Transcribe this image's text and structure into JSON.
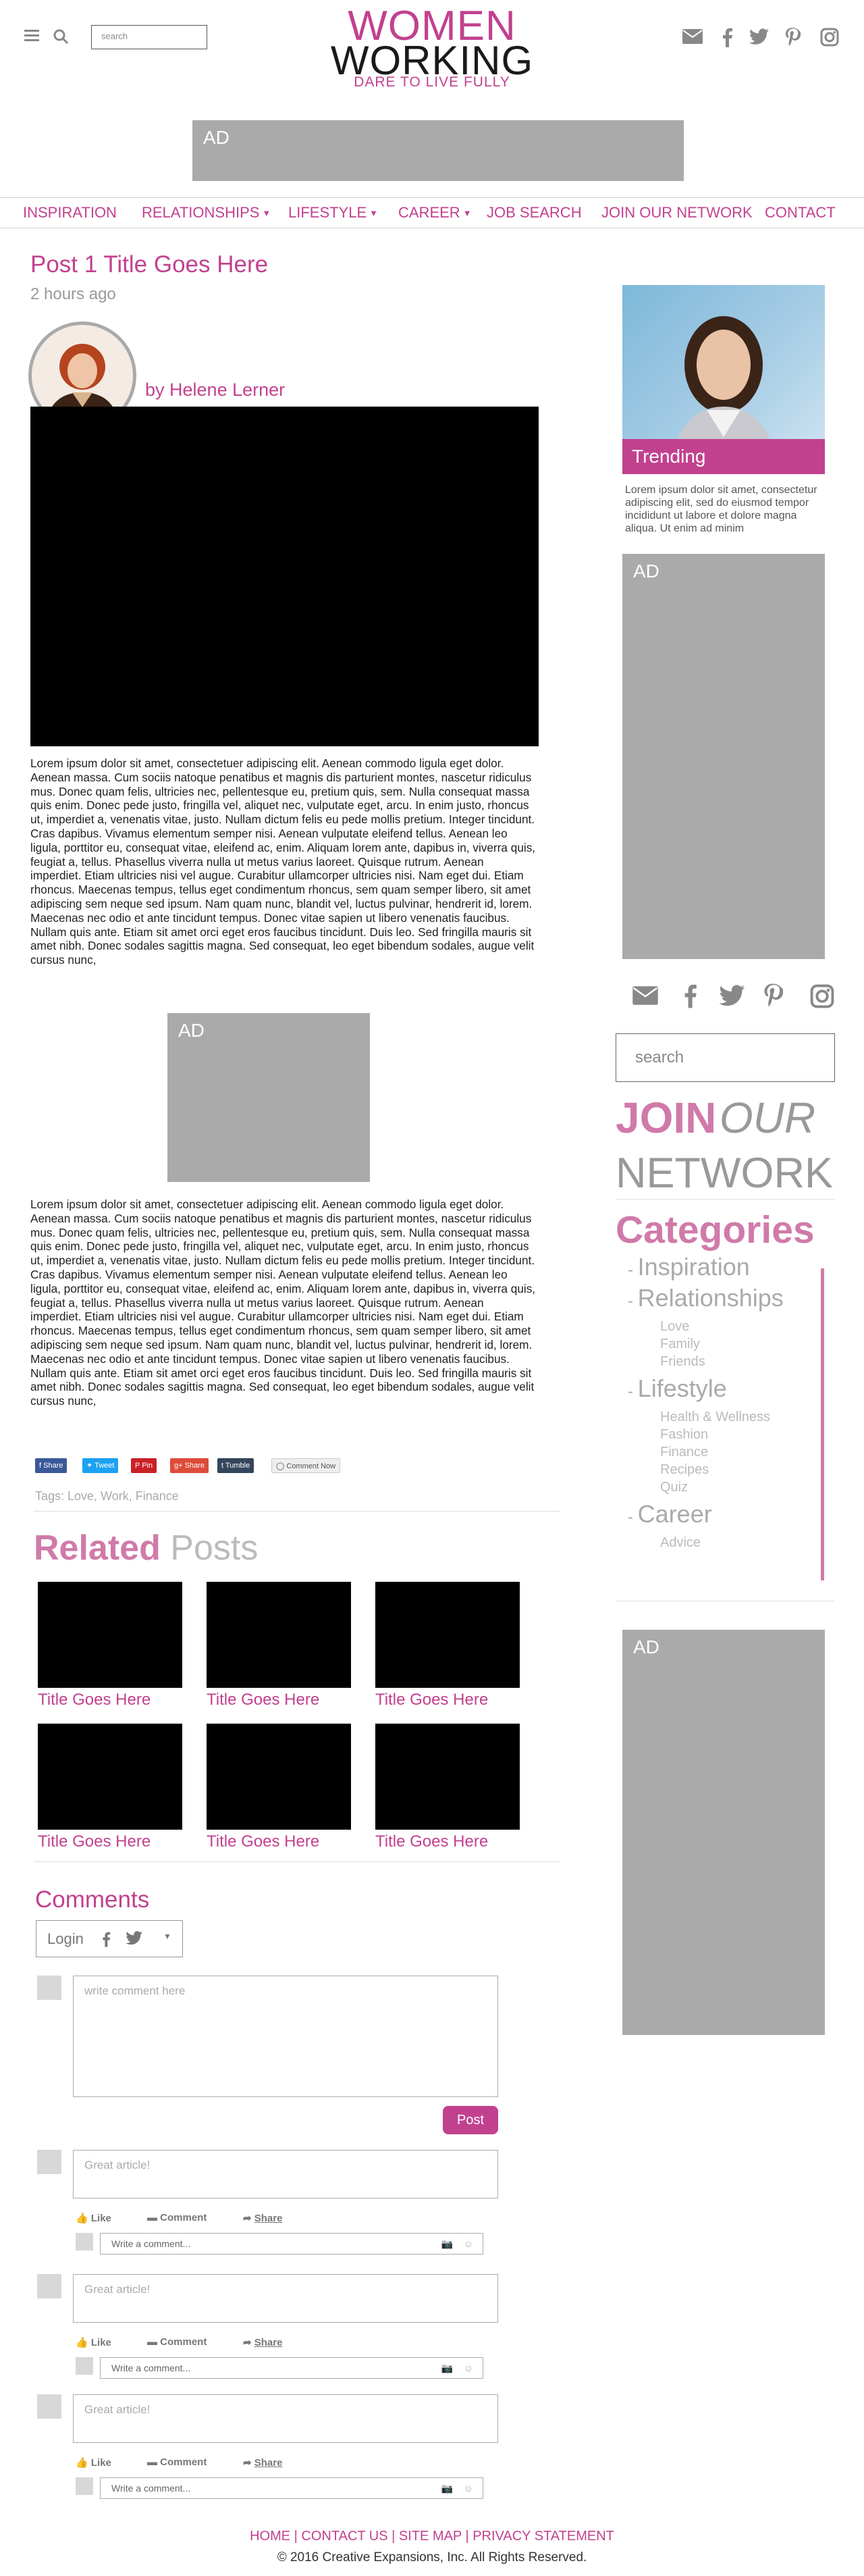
{
  "header": {
    "search_placeholder": "search",
    "logo": {
      "line1": "WOMEN",
      "line2": "WORKING",
      "tagline": "DARE TO LIVE FULLY"
    },
    "ad_label": "AD",
    "social_icons": [
      "envelope-icon",
      "facebook-icon",
      "twitter-icon",
      "pinterest-icon",
      "instagram-icon"
    ]
  },
  "nav": {
    "items": [
      {
        "label": "INSPIRATION",
        "dropdown": false
      },
      {
        "label": "RELATIONSHIPS",
        "dropdown": true
      },
      {
        "label": "LIFESTYLE",
        "dropdown": true
      },
      {
        "label": "CAREER",
        "dropdown": true
      },
      {
        "label": "JOB SEARCH",
        "dropdown": false
      },
      {
        "label": "JOIN OUR NETWORK",
        "dropdown": false
      },
      {
        "label": "CONTACT",
        "dropdown": false
      }
    ]
  },
  "post": {
    "title": "Post 1 Title Goes Here",
    "time": "2 hours ago",
    "author": "by Helene Lerner",
    "paragraph1": "Lorem ipsum dolor sit amet, consectetuer adipiscing elit. Aenean commodo ligula eget dolor. Aenean massa. Cum sociis natoque penatibus et magnis dis parturient montes, nascetur ridiculus mus. Donec quam felis, ultricies nec, pellentesque eu, pretium quis, sem. Nulla consequat massa quis enim. Donec pede justo, fringilla vel, aliquet nec, vulputate eget, arcu. In enim justo, rhoncus ut, imperdiet a, venenatis vitae, justo. Nullam dictum felis eu pede mollis pretium. Integer tincidunt. Cras dapibus. Vivamus elementum semper nisi. Aenean vulputate eleifend tellus. Aenean leo ligula, porttitor eu, consequat vitae, eleifend ac, enim. Aliquam lorem ante, dapibus in, viverra quis, feugiat a, tellus. Phasellus viverra nulla ut metus varius laoreet. Quisque rutrum. Aenean imperdiet. Etiam ultricies nisi vel augue. Curabitur ullamcorper ultricies nisi. Nam eget dui. Etiam rhoncus. Maecenas tempus, tellus eget condimentum rhoncus, sem quam semper libero, sit amet adipiscing sem neque sed ipsum. Nam quam nunc, blandit vel, luctus pulvinar, hendrerit id, lorem. Maecenas nec odio et ante tincidunt tempus. Donec vitae sapien ut libero venenatis faucibus. Nullam quis ante. Etiam sit amet orci eget eros faucibus tincidunt. Duis leo. Sed fringilla mauris sit amet nibh. Donec sodales sagittis magna. Sed consequat, leo eget bibendum sodales, augue velit cursus nunc,",
    "ad_label": "AD",
    "paragraph2": "Lorem ipsum dolor sit amet, consectetuer adipiscing elit. Aenean commodo ligula eget dolor. Aenean massa. Cum sociis natoque penatibus et magnis dis parturient montes, nascetur ridiculus mus. Donec quam felis, ultricies nec, pellentesque eu, pretium quis, sem. Nulla consequat massa quis enim. Donec pede justo, fringilla vel, aliquet nec, vulputate eget, arcu. In enim justo, rhoncus ut, imperdiet a, venenatis vitae, justo. Nullam dictum felis eu pede mollis pretium. Integer tincidunt. Cras dapibus. Vivamus elementum semper nisi. Aenean vulputate eleifend tellus. Aenean leo ligula, porttitor eu, consequat vitae, eleifend ac, enim. Aliquam lorem ante, dapibus in, viverra quis, feugiat a, tellus. Phasellus viverra nulla ut metus varius laoreet. Quisque rutrum. Aenean imperdiet. Etiam ultricies nisi vel augue. Curabitur ullamcorper ultricies nisi. Nam eget dui. Etiam rhoncus. Maecenas tempus, tellus eget condimentum rhoncus, sem quam semper libero, sit amet adipiscing sem neque sed ipsum. Nam quam nunc, blandit vel, luctus pulvinar, hendrerit id, lorem. Maecenas nec odio et ante tincidunt tempus. Donec vitae sapien ut libero venenatis faucibus. Nullam quis ante. Etiam sit amet orci eget eros faucibus tincidunt. Duis leo. Sed fringilla mauris sit amet nibh. Donec sodales sagittis magna. Sed consequat, leo eget bibendum sodales, augue velit cursus nunc,",
    "share": {
      "facebook": "Share",
      "twitter": "Tweet",
      "pinterest": "Pin",
      "google": "Share",
      "tumblr": "Tumble",
      "comment": "Comment Now"
    },
    "tags": "Tags: Love, Work, Finance"
  },
  "related": {
    "heading_bold": "Related",
    "heading_light": "Posts",
    "items": [
      {
        "title": "Title Goes Here"
      },
      {
        "title": "Title Goes Here"
      },
      {
        "title": "Title Goes Here"
      },
      {
        "title": "Title Goes Here"
      },
      {
        "title": "Title Goes Here"
      },
      {
        "title": "Title Goes Here"
      }
    ]
  },
  "comments": {
    "heading": "Comments",
    "login_label": "Login",
    "new_comment_placeholder": "write comment here",
    "post_button": "Post",
    "items": [
      {
        "text": "Great article!"
      },
      {
        "text": "Great article!"
      },
      {
        "text": "Great article!"
      }
    ],
    "actions": {
      "like": "Like",
      "comment": "Comment",
      "share": "Share"
    },
    "reply_placeholder": "Write a comment..."
  },
  "sidebar": {
    "trending_label": "Trending",
    "trending_text": "Lorem ipsum dolor sit amet, consectetur adipiscing elit, sed do eiusmod tempor incididunt ut labore et dolore magna aliqua. Ut enim ad minim",
    "ad_label": "AD",
    "search_placeholder": "search",
    "join": {
      "word1": "JOIN",
      "word2": "OUR",
      "word3": "NETWORK"
    },
    "categories_heading": "Categories",
    "categories": [
      {
        "label": "Inspiration",
        "subs": []
      },
      {
        "label": "Relationships",
        "subs": [
          "Love",
          "Family",
          "Friends"
        ]
      },
      {
        "label": "Lifestyle",
        "subs": [
          "Health & Wellness",
          "Fashion",
          "Finance",
          "Recipes",
          "Quiz"
        ]
      },
      {
        "label": "Career",
        "subs": [
          "Advice"
        ]
      }
    ],
    "bottom_ad_label": "AD"
  },
  "footer": {
    "links": "HOME | CONTACT US | SITE MAP | PRIVACY STATEMENT",
    "copyright": "© 2016 Creative Expansions, Inc. All Rights Reserved."
  },
  "colors": {
    "accent": "#c2418f",
    "accent_light": "#d07aa9",
    "ad_gray": "#aaaaaa"
  }
}
